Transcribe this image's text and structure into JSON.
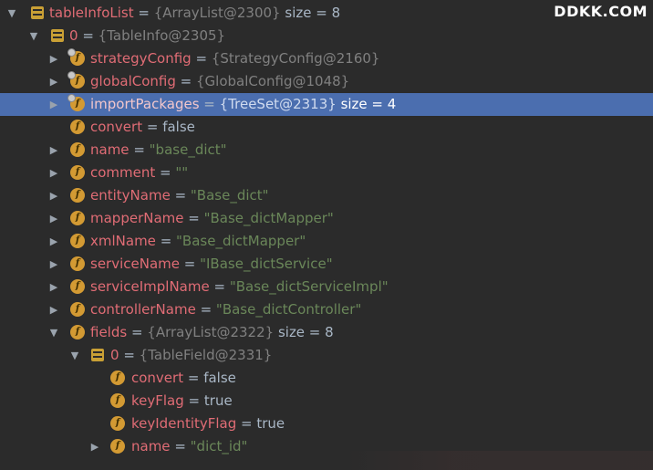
{
  "watermark": "DDKK.COM",
  "rows": [
    {
      "name": "tableInfoList",
      "eq": " = ",
      "ref": "{ArrayList@2300}",
      "extra": "  size = 8"
    },
    {
      "name": "0",
      "eq": " = ",
      "ref": "{TableInfo@2305}"
    },
    {
      "name": "strategyConfig",
      "eq": " = ",
      "ref": "{StrategyConfig@2160}"
    },
    {
      "name": "globalConfig",
      "eq": " = ",
      "ref": "{GlobalConfig@1048}"
    },
    {
      "name": "importPackages",
      "eq": " = ",
      "ref": "{TreeSet@2313}",
      "extra": "  size = 4"
    },
    {
      "name": "convert",
      "eq": " = ",
      "value": "false"
    },
    {
      "name": "name",
      "eq": " = ",
      "str": "\"base_dict\""
    },
    {
      "name": "comment",
      "eq": " = ",
      "str": "\"\""
    },
    {
      "name": "entityName",
      "eq": " = ",
      "str": "\"Base_dict\""
    },
    {
      "name": "mapperName",
      "eq": " = ",
      "str": "\"Base_dictMapper\""
    },
    {
      "name": "xmlName",
      "eq": " = ",
      "str": "\"Base_dictMapper\""
    },
    {
      "name": "serviceName",
      "eq": " = ",
      "str": "\"IBase_dictService\""
    },
    {
      "name": "serviceImplName",
      "eq": " = ",
      "str": "\"Base_dictServiceImpl\""
    },
    {
      "name": "controllerName",
      "eq": " = ",
      "str": "\"Base_dictController\""
    },
    {
      "name": "fields",
      "eq": " = ",
      "ref": "{ArrayList@2322}",
      "extra": "  size = 8"
    },
    {
      "name": "0",
      "eq": " = ",
      "ref": "{TableField@2331}"
    },
    {
      "name": "convert",
      "eq": " = ",
      "value": "false"
    },
    {
      "name": "keyFlag",
      "eq": " = ",
      "value": "true"
    },
    {
      "name": "keyIdentityFlag",
      "eq": " = ",
      "value": "true"
    },
    {
      "name": "name",
      "eq": " = ",
      "str": "\"dict_id\""
    }
  ]
}
